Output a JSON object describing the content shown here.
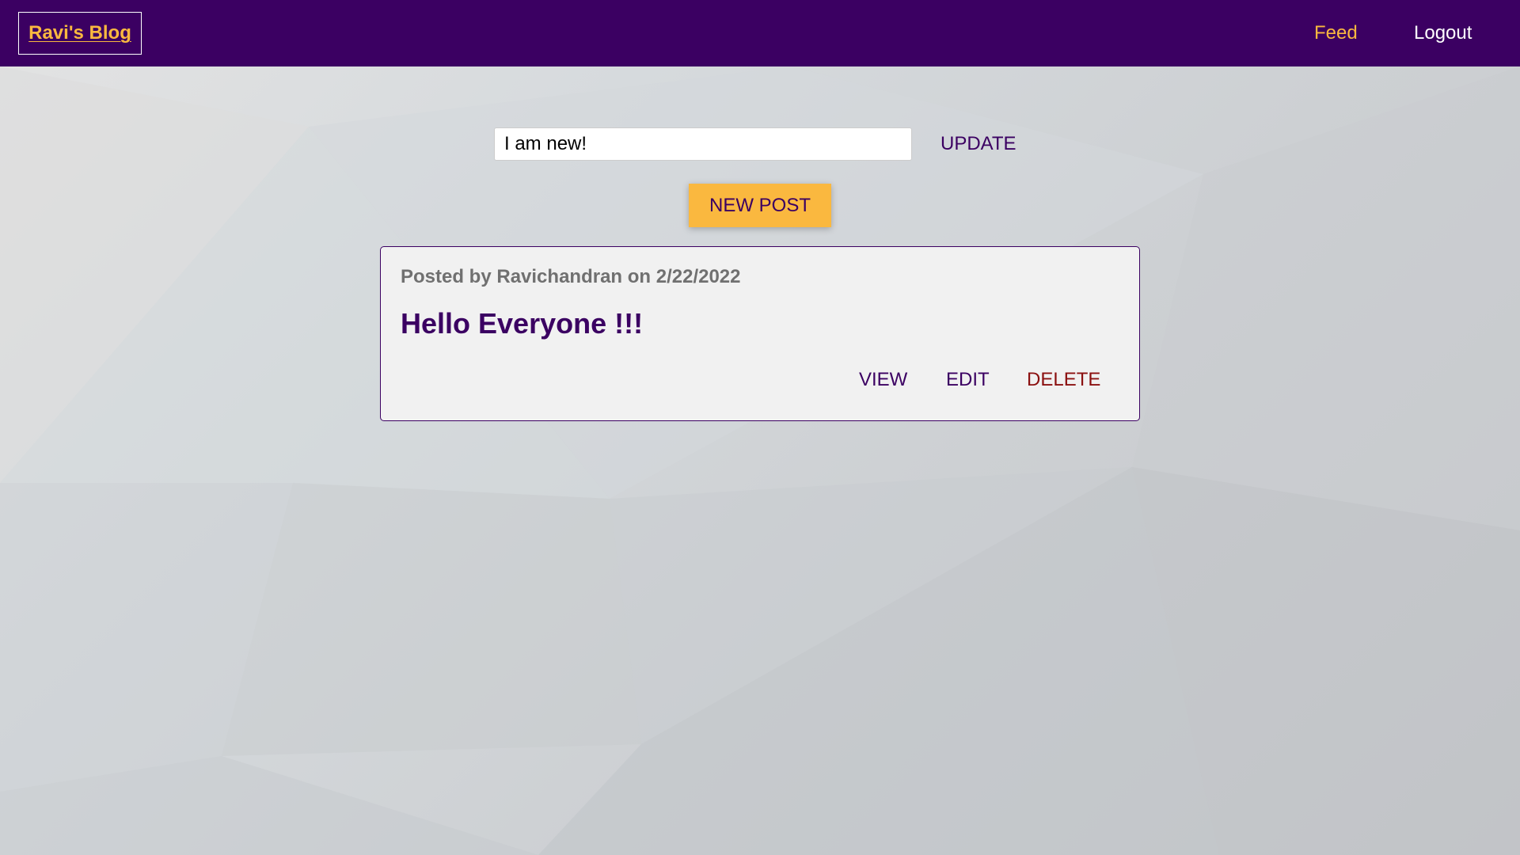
{
  "navbar": {
    "brand": "Ravi's Blog",
    "links": [
      {
        "label": "Feed",
        "active": true
      },
      {
        "label": "Logout",
        "active": false
      }
    ]
  },
  "status": {
    "value": "I am new!",
    "update_label": "UPDATE"
  },
  "new_post_label": "NEW POST",
  "posts": [
    {
      "meta": "Posted by Ravichandran on 2/22/2022",
      "title": "Hello Everyone !!!",
      "actions": {
        "view": "VIEW",
        "edit": "EDIT",
        "delete": "DELETE"
      }
    }
  ],
  "colors": {
    "primary": "#3b0062",
    "accent": "#fab83f",
    "danger": "#8b1010",
    "card_bg": "#f1f1f1"
  }
}
